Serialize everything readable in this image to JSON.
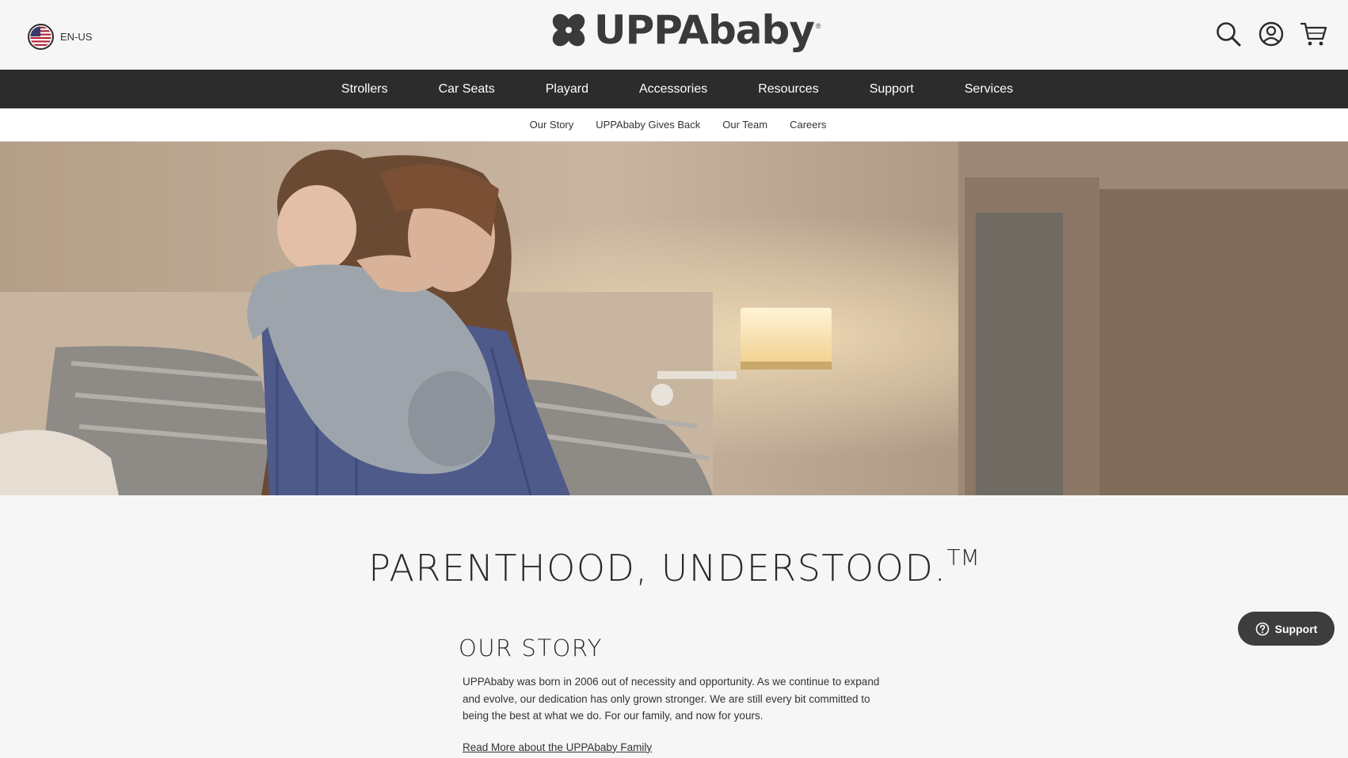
{
  "locale": {
    "label": "EN-US",
    "icon": "us-flag-icon"
  },
  "brand": {
    "name": "UPPAbaby",
    "reg_mark": "®"
  },
  "header_icons": [
    "search-icon",
    "account-icon",
    "cart-icon"
  ],
  "main_nav": [
    "Strollers",
    "Car Seats",
    "Playard",
    "Accessories",
    "Resources",
    "Support",
    "Services"
  ],
  "sub_nav": [
    "Our Story",
    "UPPAbaby Gives Back",
    "Our Team",
    "Careers"
  ],
  "hero": {
    "alt": "Mother hugging toddler in a bedroom"
  },
  "headline": {
    "text": "PARENTHOOD, UNDERSTOOD.",
    "tm": "TM"
  },
  "story": {
    "title": "OUR STORY",
    "body": "UPPAbaby was born in 2006 out of necessity and opportunity. As we continue to expand and evolve, our dedication has only grown stronger. We are still every bit committed to being the best at what we do. For our family, and now for yours.",
    "link": "Read More about the UPPAbaby Family"
  },
  "support_button": {
    "label": "Support"
  },
  "colors": {
    "nav_bg": "#2c2c2c",
    "page_bg": "#f6f6f6",
    "support_bg": "#3d3d3d"
  }
}
